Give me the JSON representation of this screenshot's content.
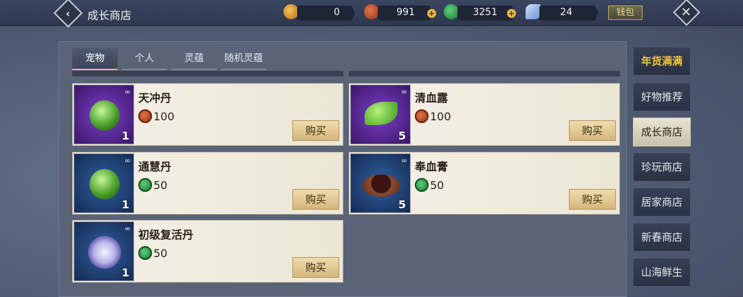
{
  "header": {
    "title": "成长商店",
    "wallet_label": "钱包",
    "currencies": [
      {
        "name": "gold-bell",
        "value": "0",
        "color": "#e69a2c"
      },
      {
        "name": "red-coin",
        "value": "991",
        "color": "#c2431d"
      },
      {
        "name": "jade-coin",
        "value": "3251",
        "color": "#2aa04a"
      },
      {
        "name": "crystal",
        "value": "24",
        "color": "#7ea6e0"
      }
    ]
  },
  "tabs": [
    "宠物",
    "个人",
    "灵蕴",
    "随机灵蕴"
  ],
  "items": [
    {
      "name": "天冲丹",
      "price": "100",
      "currency": "red-coin",
      "qty": "1",
      "thumb": "purple",
      "buy": "购买"
    },
    {
      "name": "清血露",
      "price": "100",
      "currency": "red-coin",
      "qty": "5",
      "thumb": "purple",
      "buy": "购买"
    },
    {
      "name": "通慧丹",
      "price": "50",
      "currency": "jade-coin",
      "qty": "1",
      "thumb": "blue",
      "buy": "购买"
    },
    {
      "name": "奉血膏",
      "price": "50",
      "currency": "jade-coin",
      "qty": "5",
      "thumb": "blue",
      "buy": "购买"
    },
    {
      "name": "初级复活丹",
      "price": "50",
      "currency": "jade-coin",
      "qty": "1",
      "thumb": "blue",
      "buy": "购买"
    }
  ],
  "sidebar": [
    "年货满满",
    "好物推荐",
    "成长商店",
    "珍玩商店",
    "居家商店",
    "新春商店",
    "山海鲜生"
  ]
}
